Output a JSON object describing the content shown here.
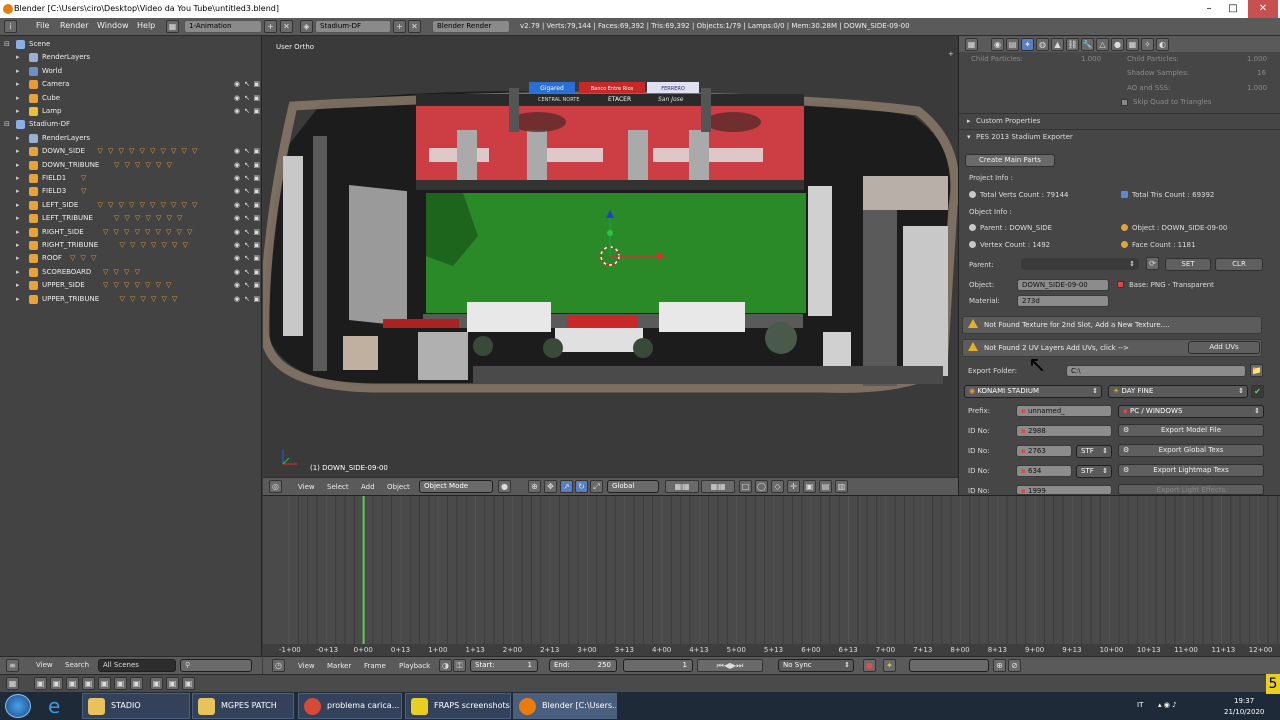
{
  "window": {
    "title": "Blender [C:\\Users\\ciro\\Desktop\\Video da You Tube\\untitled3.blend]",
    "min": "–",
    "max": "□",
    "close": "✕"
  },
  "menubar": {
    "items": [
      "File",
      "Render",
      "Window",
      "Help"
    ],
    "screen_layout": "1-Animation",
    "scene": "Stadium-DF",
    "render_engine": "Blender Render",
    "stats": "v2.79 | Verts:79,144 | Faces:69,392 | Tris:69,392 | Objects:1/79 | Lamps:0/0 | Mem:30.28M | DOWN_SIDE-09-00"
  },
  "outliner": {
    "rows": [
      {
        "label": "Scene",
        "indent": 0,
        "icon": "scene-icon",
        "color": "#8ab0e8",
        "tri": 0
      },
      {
        "label": "RenderLayers",
        "indent": 1,
        "icon": "renderlayers-icon",
        "color": "#9ab0d0",
        "tri": 0
      },
      {
        "label": "World",
        "indent": 1,
        "icon": "world-icon",
        "color": "#6c8fc8",
        "tri": 0
      },
      {
        "label": "Camera",
        "indent": 1,
        "icon": "camera-icon",
        "color": "#e89a3a",
        "tri": 0
      },
      {
        "label": "Cube",
        "indent": 1,
        "icon": "mesh-icon",
        "color": "#e8a23a",
        "tri": 0
      },
      {
        "label": "Lamp",
        "indent": 1,
        "icon": "lamp-icon",
        "color": "#e8c23a",
        "tri": 0
      },
      {
        "label": "Stadium-DF",
        "indent": 0,
        "icon": "scene-icon",
        "color": "#8ab0e8",
        "tri": 0
      },
      {
        "label": "RenderLayers",
        "indent": 1,
        "icon": "renderlayers-icon",
        "color": "#9ab0d0",
        "tri": 0
      },
      {
        "label": "DOWN_SIDE",
        "indent": 1,
        "icon": "empty-icon",
        "color": "#e8a23a",
        "tri": 10
      },
      {
        "label": "DOWN_TRIBUNE",
        "indent": 1,
        "icon": "empty-icon",
        "color": "#e8a23a",
        "tri": 6
      },
      {
        "label": "FIELD1",
        "indent": 1,
        "icon": "empty-icon",
        "color": "#e8a23a",
        "tri": 1
      },
      {
        "label": "FIELD3",
        "indent": 1,
        "icon": "empty-icon",
        "color": "#e8a23a",
        "tri": 1
      },
      {
        "label": "LEFT_SIDE",
        "indent": 1,
        "icon": "empty-icon",
        "color": "#e8a23a",
        "tri": 10
      },
      {
        "label": "LEFT_TRIBUNE",
        "indent": 1,
        "icon": "empty-icon",
        "color": "#e8a23a",
        "tri": 7
      },
      {
        "label": "RIGHT_SIDE",
        "indent": 1,
        "icon": "empty-icon",
        "color": "#e8a23a",
        "tri": 9
      },
      {
        "label": "RIGHT_TRIBUNE",
        "indent": 1,
        "icon": "empty-icon",
        "color": "#e8a23a",
        "tri": 7
      },
      {
        "label": "ROOF",
        "indent": 1,
        "icon": "empty-icon",
        "color": "#e8a23a",
        "tri": 3
      },
      {
        "label": "SCOREBOARD",
        "indent": 1,
        "icon": "empty-icon",
        "color": "#e8a23a",
        "tri": 4
      },
      {
        "label": "UPPER_SIDE",
        "indent": 1,
        "icon": "empty-icon",
        "color": "#e8a23a",
        "tri": 7
      },
      {
        "label": "UPPER_TRIBUNE",
        "indent": 1,
        "icon": "empty-icon",
        "color": "#e8a23a",
        "tri": 6
      }
    ],
    "footer": {
      "view": "View",
      "search": "Search",
      "scenes": "All Scenes"
    }
  },
  "viewport": {
    "label": "User Ortho",
    "object_label": "(1) DOWN_SIDE-09-00",
    "ads": [
      "Gigared",
      "Banco Entre Rios",
      "FERRERO"
    ],
    "stand_text": [
      "CENTRAL NORTE",
      "ETACER",
      "San Jose"
    ],
    "header": {
      "view": "View",
      "select": "Select",
      "add": "Add",
      "object": "Object",
      "mode": "Object Mode",
      "orientation": "Global"
    }
  },
  "properties": {
    "top": {
      "child_particles_a": "Child Particles:",
      "child_particles_a_val": "1.000",
      "child_particles_b": "Child Particles:",
      "child_particles_b_val": "1.000",
      "shadow_samples": "Shadow Samples:",
      "shadow_samples_val": "16",
      "ao_sss": "AO and SSS:",
      "ao_sss_val": "1.000",
      "skip_quad": "Skip Quad to Triangles"
    },
    "custom_properties": "Custom Properties",
    "panel_title": "PES 2013 Stadium Exporter",
    "create_main_parts": "Create Main Parts",
    "project_info": "Project Info :",
    "total_verts": "Total Verts Count : 79144",
    "total_tris": "Total Tris Count : 69392",
    "object_info": "Object Info :",
    "parent_info": "Parent : DOWN_SIDE",
    "object_name_info": "Object : DOWN_SIDE-09-00",
    "vertex_count": "Vertex Count : 1492",
    "face_count": "Face Count : 1181",
    "parent_label": "Parent:",
    "set": "SET",
    "clr": "CLR",
    "object_label": "Object:",
    "object_value": "DOWN_SIDE-09-00",
    "base_info": "Base: PNG - Transparent",
    "material_label": "Material:",
    "material_value": "273d",
    "warn1": "Not Found Texture for 2nd Slot, Add a New Texture....",
    "warn2": "Not Found 2 UV Layers Add UVs, click -->",
    "add_uvs": "Add UVs",
    "export_folder_label": "Export Folder:",
    "export_folder_value": "C:\\",
    "stadium": "KONAMI STADIUM",
    "weather": "DAY FINE",
    "prefix_label": "Prefix:",
    "prefix_value": "unnamed_",
    "platform": "PC / WINDOWS",
    "id_label": "ID No:",
    "id1": "2988",
    "id2": "2763",
    "id3": "634",
    "id4": "1999",
    "stf": "STF",
    "export_model": "Export Model File",
    "export_global": "Export Global Texs",
    "export_lightmap": "Export Lightmap Texs",
    "export_effects": "Export Light Effects"
  },
  "timeline": {
    "ticks": [
      "-1+00",
      "-0+13",
      "0+00",
      "0+13",
      "1+00",
      "1+13",
      "2+00",
      "2+13",
      "3+00",
      "3+13",
      "4+00",
      "4+13",
      "5+00",
      "5+13",
      "6+00",
      "6+13",
      "7+00",
      "7+13",
      "8+00",
      "8+13",
      "9+00",
      "9+13",
      "10+00",
      "10+13",
      "11+00",
      "11+13",
      "12+00"
    ],
    "header": {
      "view": "View",
      "marker": "Marker",
      "frame": "Frame",
      "playback": "Playback",
      "start_label": "Start:",
      "start": "1",
      "end_label": "End:",
      "end": "250",
      "current": "1",
      "sync": "No Sync"
    }
  },
  "taskbar": {
    "items": [
      {
        "label": "STADIO",
        "color": "#e8c25a"
      },
      {
        "label": "MGPES PATCH",
        "color": "#e8c25a"
      },
      {
        "label": "problema carica...",
        "color": "#d84a38"
      },
      {
        "label": "FRAPS screenshots",
        "color": "#e8d020"
      },
      {
        "label": "Blender [C:\\Users...",
        "color": "#e87d0d"
      }
    ],
    "lang": "IT",
    "time": "19:37",
    "date": "21/10/2020",
    "fraps": "5"
  }
}
